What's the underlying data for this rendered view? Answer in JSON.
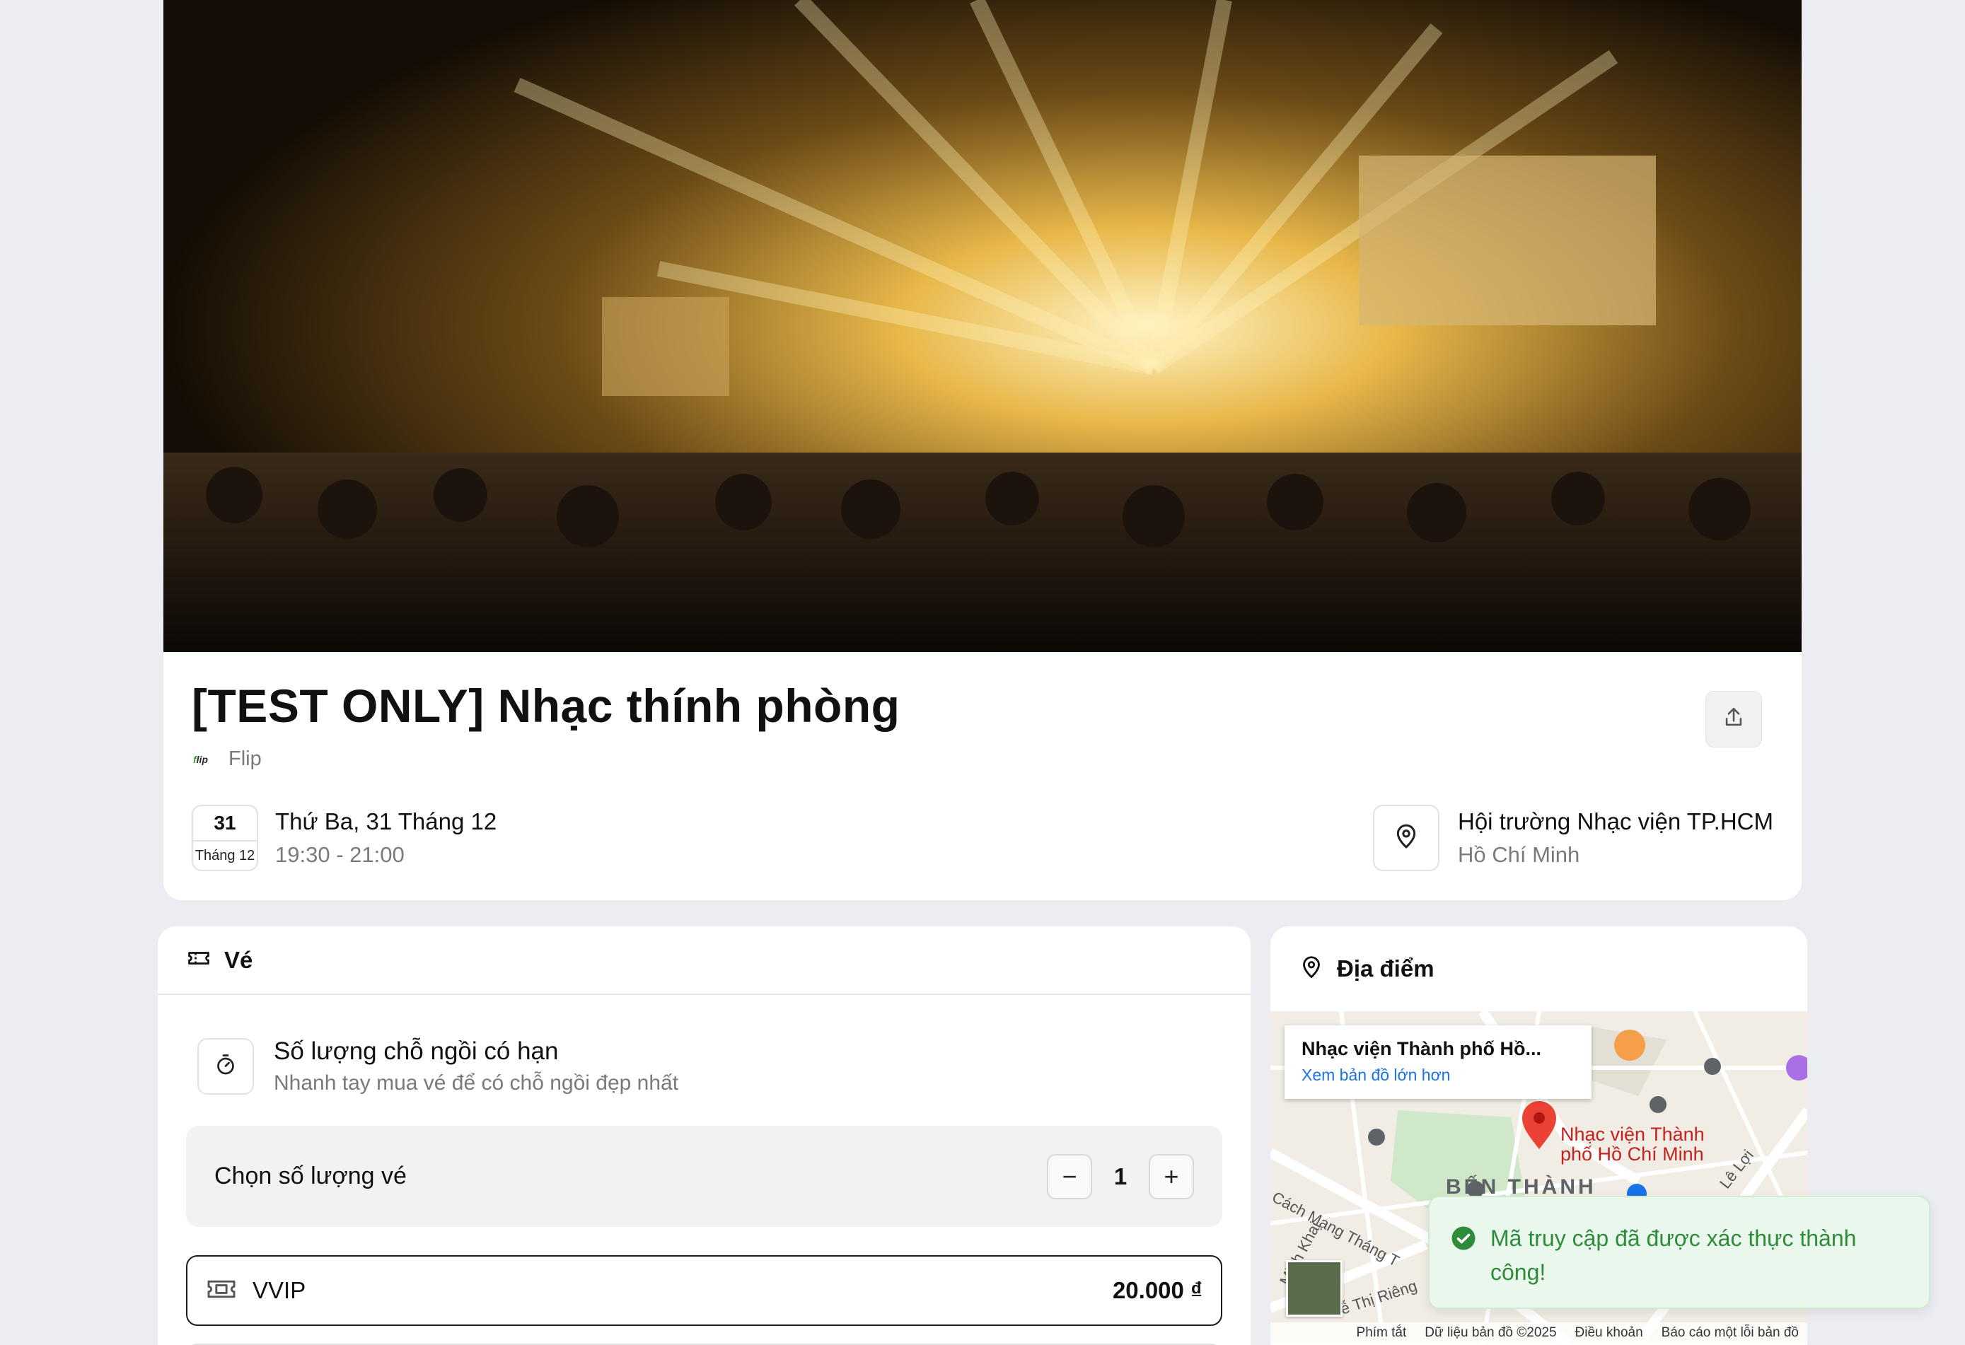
{
  "event": {
    "title": "[TEST ONLY] Nhạc thính phòng",
    "organizer": "Flip",
    "date_day": "31",
    "date_month": "Tháng 12",
    "date_full": "Thứ Ba, 31 Tháng 12",
    "time_range": "19:30 - 21:00",
    "venue_name": "Hội trường Nhạc viện TP.HCM",
    "venue_city": "Hồ Chí Minh"
  },
  "tickets": {
    "heading": "Vé",
    "limit_title": "Số lượng chỗ ngồi có hạn",
    "limit_subtitle": "Nhanh tay mua vé để có chỗ ngồi đẹp nhất",
    "qty_label": "Chọn số lượng vé",
    "qty_value": "1",
    "minus": "−",
    "plus": "+",
    "items": [
      {
        "name": "VVIP",
        "price": "20.000 ₫"
      }
    ]
  },
  "location": {
    "heading": "Địa điểm",
    "map_card_name": "Nhạc viện Thành phố Hồ...",
    "map_card_link": "Xem bản đồ lớn hơn",
    "place_label_1": "Nhạc viện Thành",
    "place_label_2": "phố Hồ Chí Minh",
    "district": "BẾN THÀNH",
    "street_1": "Cách Mạng Tháng T",
    "street_2": "Lê Lợi",
    "street_3": "Minh Khai",
    "street_4": "ễ Thị Riêng",
    "footer": [
      "Phím tắt",
      "Dữ liệu bản đồ ©2025",
      "Điều khoản",
      "Báo cáo một lỗi bản đồ"
    ]
  },
  "toast": {
    "message": "Mã truy cập đã được xác thực thành công!"
  },
  "colors": {
    "success": "#2e8b3a",
    "link": "#1a73e8",
    "map_pin": "#ea4335"
  },
  "icons": [
    "share-icon",
    "map-pin-icon",
    "ticket-icon",
    "stopwatch-icon",
    "check-circle-icon"
  ]
}
